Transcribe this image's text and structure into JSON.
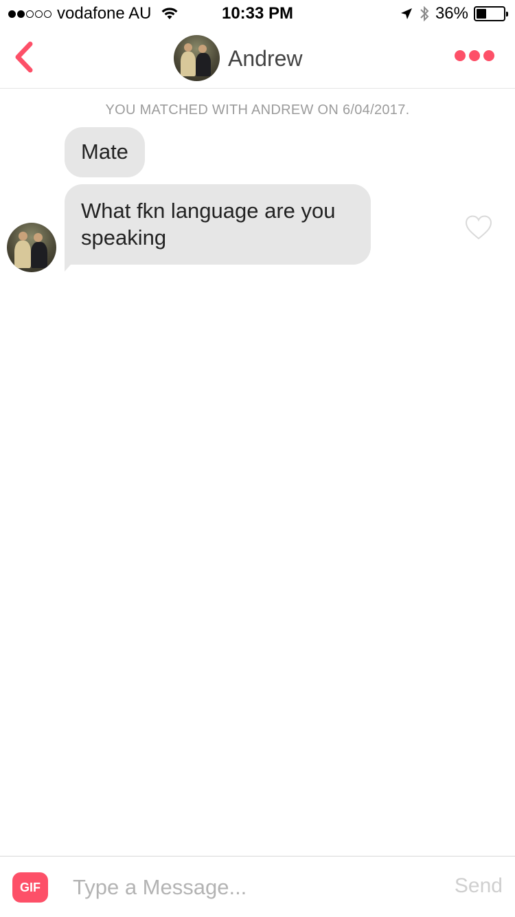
{
  "status_bar": {
    "carrier": "vodafone AU",
    "time": "10:33 PM",
    "battery_percent": "36%",
    "battery_level": 0.36,
    "signal_bars_filled": 2,
    "signal_bars_total": 5
  },
  "nav": {
    "title": "Andrew",
    "accent_color": "#fd5068"
  },
  "chat": {
    "match_note": "YOU MATCHED WITH ANDREW ON 6/04/2017.",
    "messages": [
      {
        "text": "Mate"
      },
      {
        "text": "What fkn language are you speaking"
      }
    ]
  },
  "input_bar": {
    "gif_label": "GIF",
    "placeholder": "Type a Message...",
    "send_label": "Send"
  },
  "icons": [
    "signal-icon",
    "wifi-icon",
    "location-arrow-icon",
    "bluetooth-icon",
    "battery-icon",
    "back-chevron-icon",
    "more-dots-icon",
    "heart-outline-icon"
  ]
}
